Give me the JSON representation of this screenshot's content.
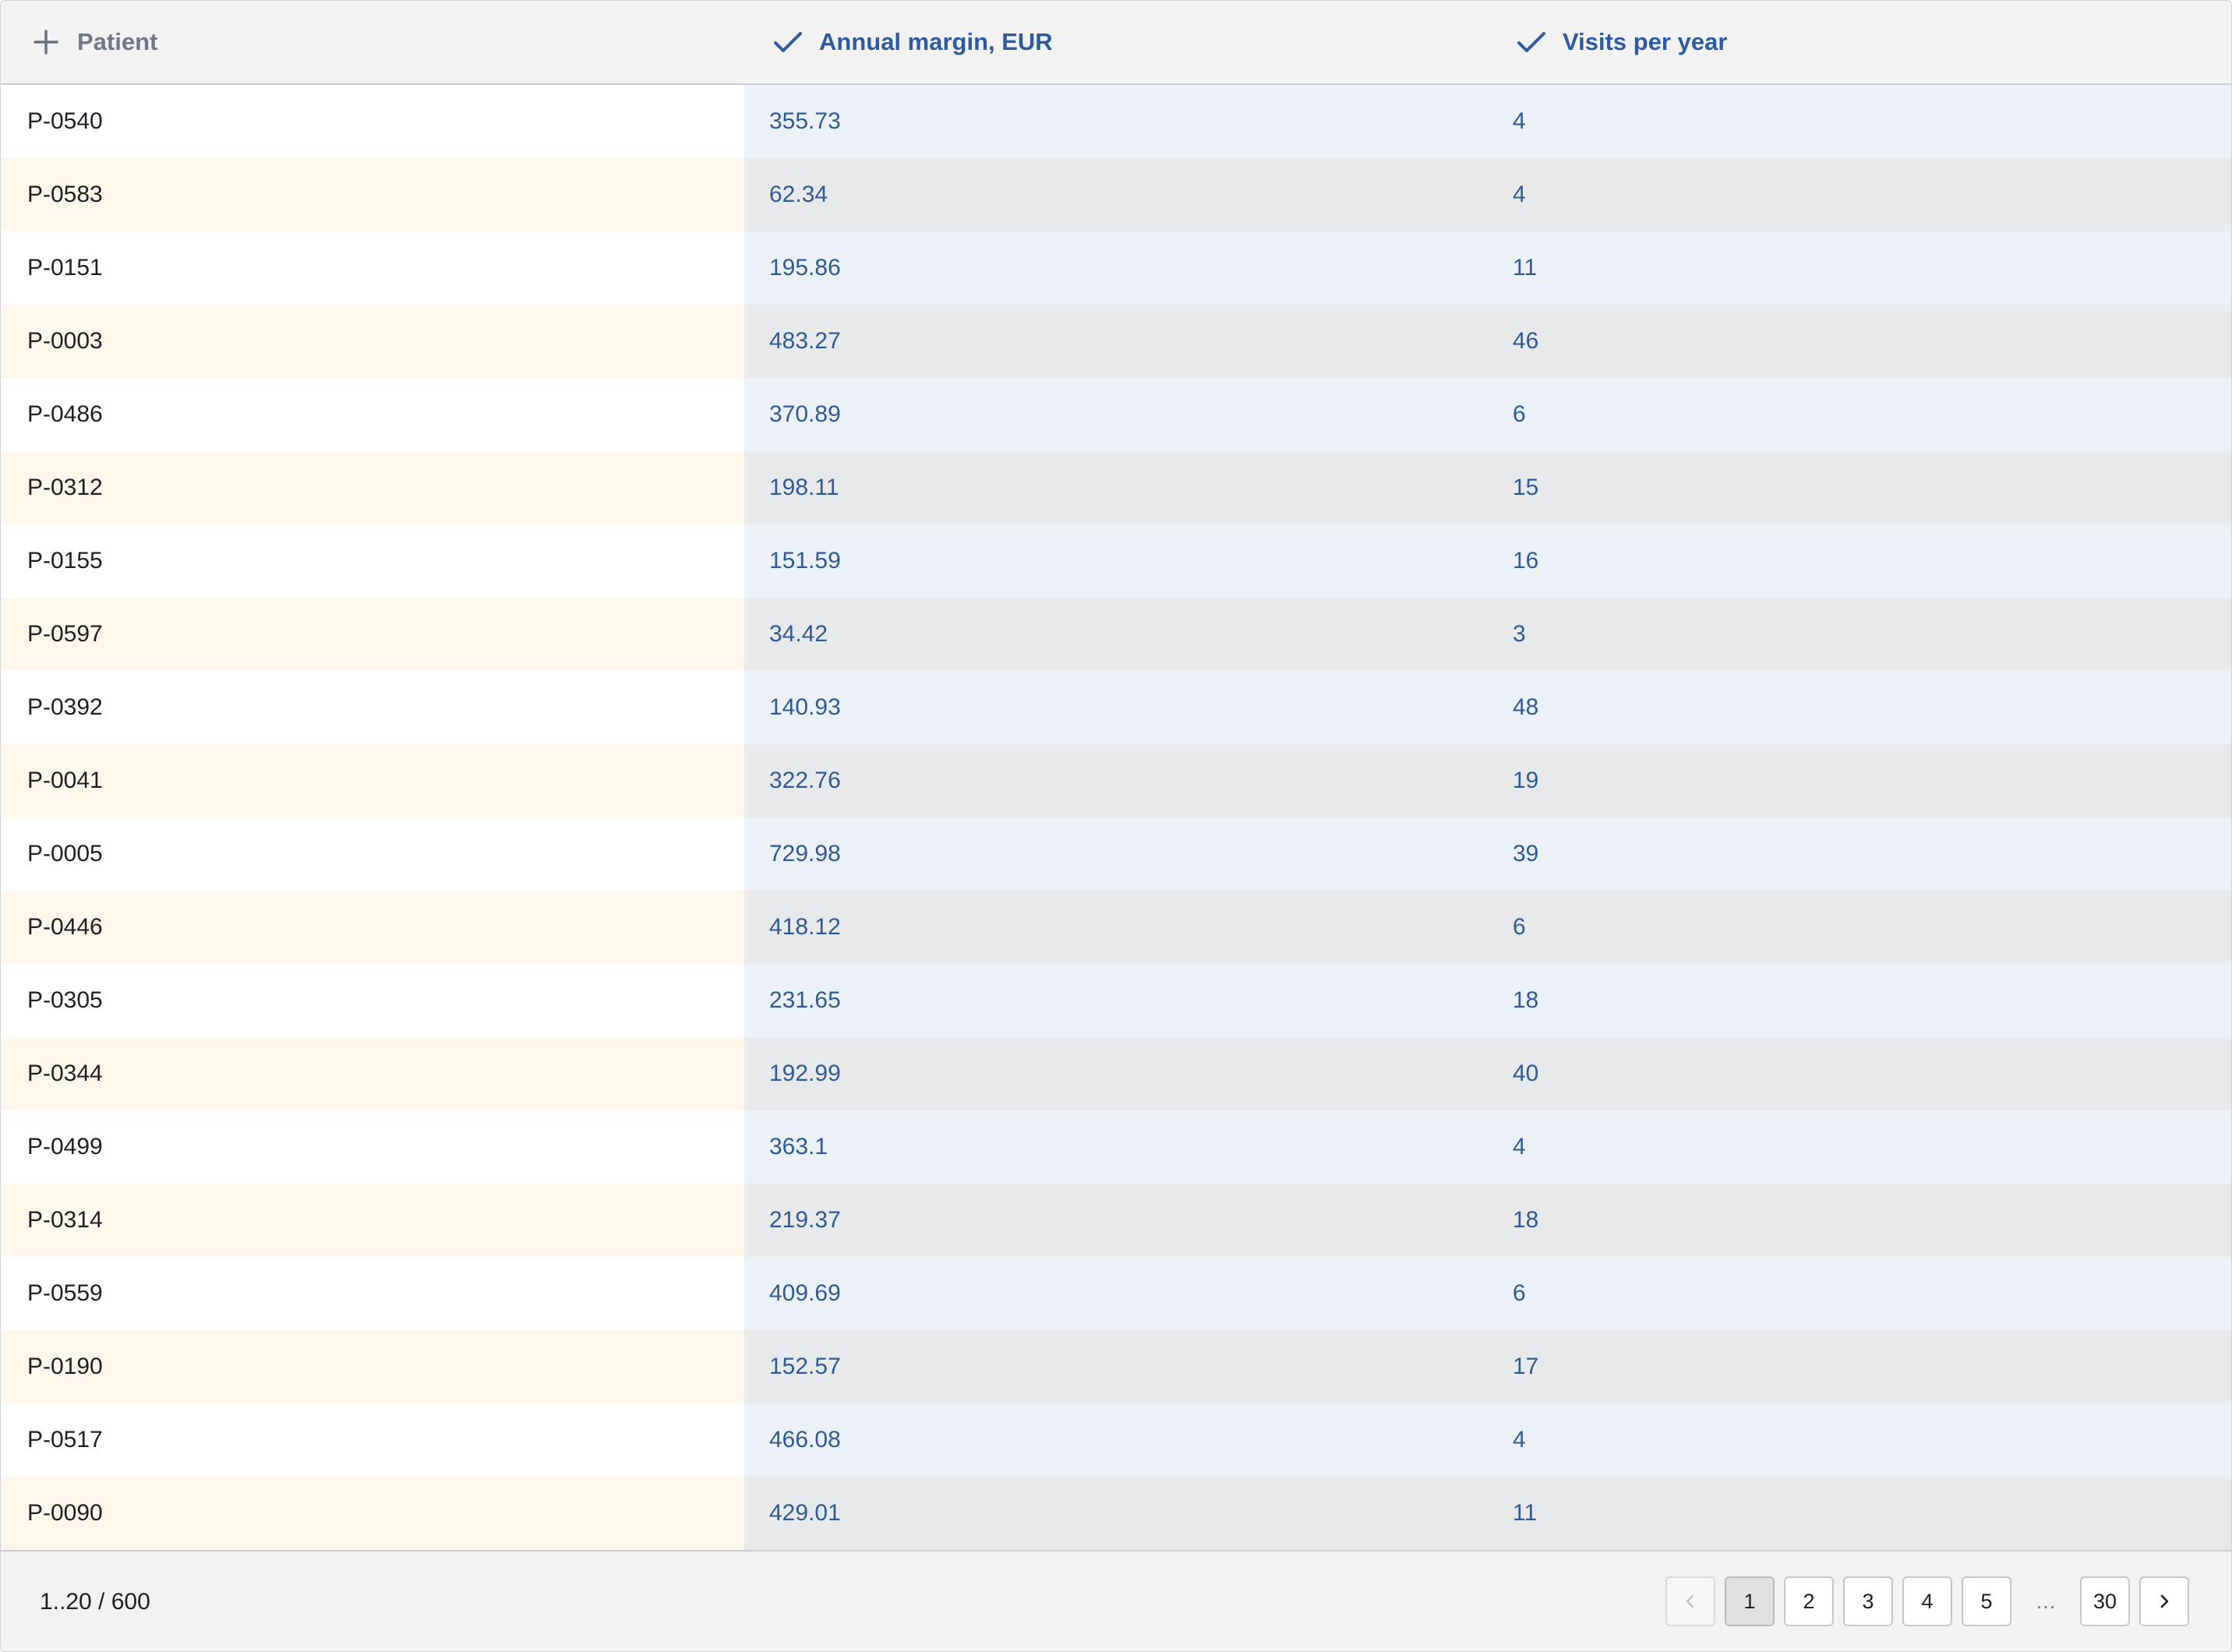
{
  "columns": [
    {
      "label": "Patient",
      "icon": "plus-icon"
    },
    {
      "label": "Annual margin, EUR",
      "icon": "checkmark-icon"
    },
    {
      "label": "Visits per year",
      "icon": "checkmark-icon"
    }
  ],
  "rows": [
    [
      "P-0540",
      "355.73",
      "4"
    ],
    [
      "P-0583",
      "62.34",
      "4"
    ],
    [
      "P-0151",
      "195.86",
      "11"
    ],
    [
      "P-0003",
      "483.27",
      "46"
    ],
    [
      "P-0486",
      "370.89",
      "6"
    ],
    [
      "P-0312",
      "198.11",
      "15"
    ],
    [
      "P-0155",
      "151.59",
      "16"
    ],
    [
      "P-0597",
      "34.42",
      "3"
    ],
    [
      "P-0392",
      "140.93",
      "48"
    ],
    [
      "P-0041",
      "322.76",
      "19"
    ],
    [
      "P-0005",
      "729.98",
      "39"
    ],
    [
      "P-0446",
      "418.12",
      "6"
    ],
    [
      "P-0305",
      "231.65",
      "18"
    ],
    [
      "P-0344",
      "192.99",
      "40"
    ],
    [
      "P-0499",
      "363.1",
      "4"
    ],
    [
      "P-0314",
      "219.37",
      "18"
    ],
    [
      "P-0559",
      "409.69",
      "6"
    ],
    [
      "P-0190",
      "152.57",
      "17"
    ],
    [
      "P-0517",
      "466.08",
      "4"
    ],
    [
      "P-0090",
      "429.01",
      "11"
    ]
  ],
  "footer": {
    "range_text": "1..20 / 600",
    "pages": [
      "1",
      "2",
      "3",
      "4",
      "5"
    ],
    "ellipsis": "…",
    "last_page": "30",
    "current_page": "1",
    "prev_icon": "chevron-left-icon",
    "next_icon": "chevron-right-icon"
  },
  "colors": {
    "header_bg": "#f2f2f2",
    "header_text_muted": "#707888",
    "accent_blue": "#2f5aa0",
    "row_odd_first": "#ffffff",
    "row_even_first": "#fff6ec",
    "row_odd_data": "#ecf1f8",
    "row_even_data": "#e8e9eb"
  }
}
